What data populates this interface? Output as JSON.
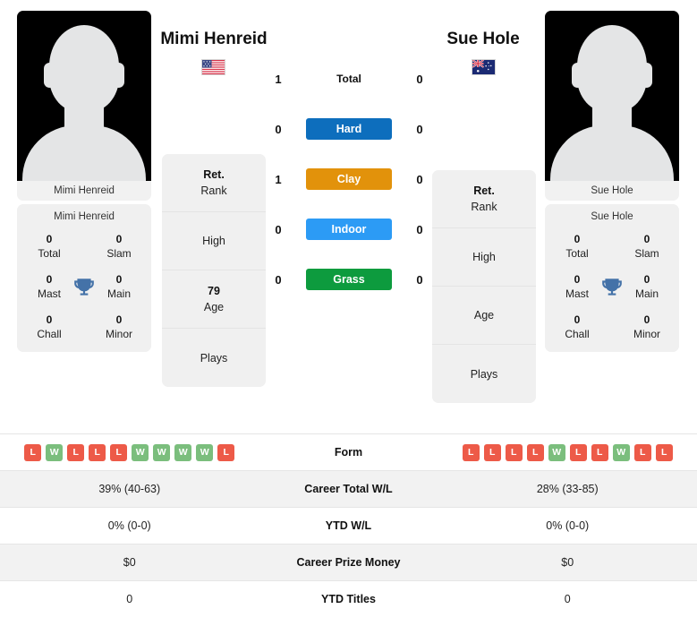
{
  "players": {
    "left": {
      "name": "Mimi Henreid",
      "photo_caption": "Mimi Henreid",
      "flag": "us-flag-icon",
      "titles": {
        "total_value": "0",
        "total_label": "Total",
        "slam_value": "0",
        "slam_label": "Slam",
        "mast_value": "0",
        "mast_label": "Mast",
        "main_value": "0",
        "main_label": "Main",
        "chall_value": "0",
        "chall_label": "Chall",
        "minor_value": "0",
        "minor_label": "Minor",
        "trophy_icon": "trophy-icon"
      },
      "info": {
        "rank_value": "Ret.",
        "rank_label": "Rank",
        "high_value": "",
        "high_label": "High",
        "age_value": "79",
        "age_label": "Age",
        "plays_value": "",
        "plays_label": "Plays"
      }
    },
    "right": {
      "name": "Sue Hole",
      "photo_caption": "Sue Hole",
      "flag": "au-flag-icon",
      "titles": {
        "total_value": "0",
        "total_label": "Total",
        "slam_value": "0",
        "slam_label": "Slam",
        "mast_value": "0",
        "mast_label": "Mast",
        "main_value": "0",
        "main_label": "Main",
        "chall_value": "0",
        "chall_label": "Chall",
        "minor_value": "0",
        "minor_label": "Minor",
        "trophy_icon": "trophy-icon"
      },
      "info": {
        "rank_value": "Ret.",
        "rank_label": "Rank",
        "high_value": "",
        "high_label": "High",
        "age_value": "",
        "age_label": "Age",
        "plays_value": "",
        "plays_label": "Plays"
      }
    }
  },
  "h2h": {
    "rows": [
      {
        "label": "Total",
        "left": "1",
        "right": "0",
        "style": "plain",
        "color": ""
      },
      {
        "label": "Hard",
        "left": "0",
        "right": "0",
        "style": "pill",
        "color": "#0d6ebd"
      },
      {
        "label": "Clay",
        "left": "1",
        "right": "0",
        "style": "pill",
        "color": "#e2920b"
      },
      {
        "label": "Indoor",
        "left": "0",
        "right": "0",
        "style": "pill",
        "color": "#2c9bf5"
      },
      {
        "label": "Grass",
        "left": "0",
        "right": "0",
        "style": "pill",
        "color": "#0d9b3e"
      }
    ]
  },
  "colors": {
    "win": "#7bbe7d",
    "loss": "#ed5a48",
    "row_alt": "#f2f2f2"
  },
  "table": {
    "form": {
      "label": "Form",
      "left": [
        "L",
        "W",
        "L",
        "L",
        "L",
        "W",
        "W",
        "W",
        "W",
        "L"
      ],
      "right": [
        "L",
        "L",
        "L",
        "L",
        "W",
        "L",
        "L",
        "W",
        "L",
        "L"
      ]
    },
    "rows": [
      {
        "label": "Career Total W/L",
        "left": "39% (40-63)",
        "right": "28% (33-85)"
      },
      {
        "label": "YTD W/L",
        "left": "0% (0-0)",
        "right": "0% (0-0)"
      },
      {
        "label": "Career Prize Money",
        "left": "$0",
        "right": "$0"
      },
      {
        "label": "YTD Titles",
        "left": "0",
        "right": "0"
      }
    ]
  }
}
